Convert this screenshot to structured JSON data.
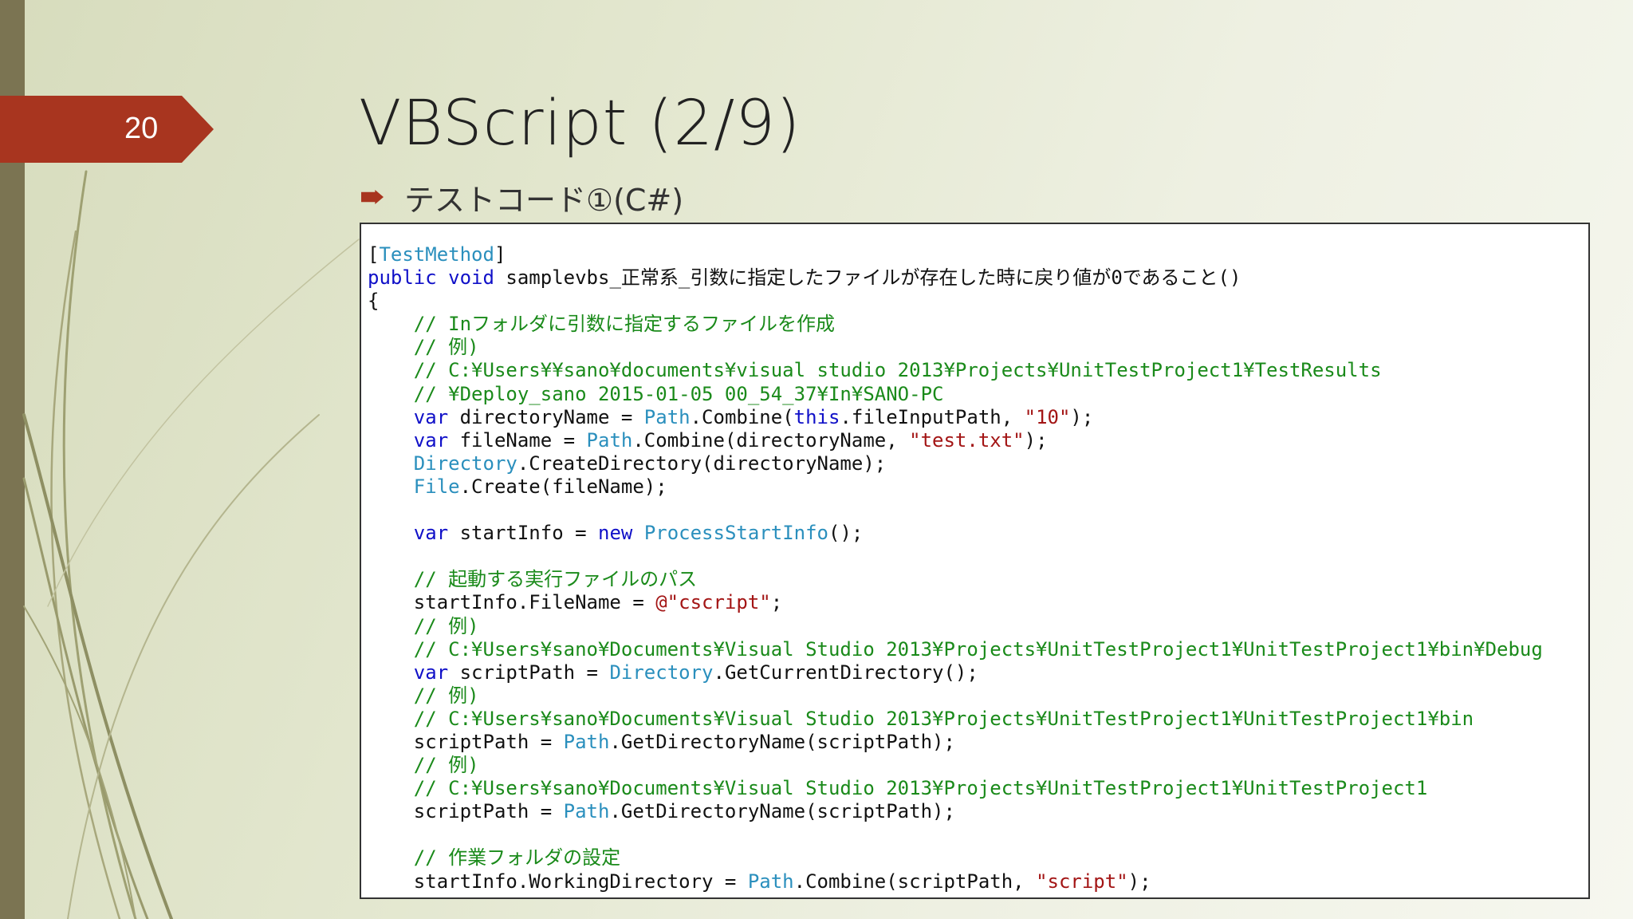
{
  "slide": {
    "number": "20",
    "title": "VBScript (2/9)",
    "bullet": "テストコード①(C#)"
  },
  "colors": {
    "accent": "#a8351f",
    "side_bar": "#7b7452",
    "keyword": "#1010c8",
    "type": "#2a8fbd",
    "comment": "#1a8a1a",
    "string": "#a31515",
    "plain": "#111111"
  },
  "code_lines": [
    [
      [
        "pl",
        "["
      ],
      [
        "ty",
        "TestMethod"
      ],
      [
        "pl",
        "]"
      ]
    ],
    [
      [
        "kw",
        "public"
      ],
      [
        "pl",
        " "
      ],
      [
        "kw",
        "void"
      ],
      [
        "pl",
        " samplevbs_正常系_引数に指定したファイルが存在した時に戻り値が0であること()"
      ]
    ],
    [
      [
        "pl",
        "{"
      ]
    ],
    [
      [
        "cm",
        "    // Inフォルダに引数に指定するファイルを作成"
      ]
    ],
    [
      [
        "cm",
        "    // 例)"
      ]
    ],
    [
      [
        "cm",
        "    // C:¥Users¥¥sano¥documents¥visual studio 2013¥Projects¥UnitTestProject1¥TestResults"
      ]
    ],
    [
      [
        "cm",
        "    // ¥Deploy_sano 2015-01-05 00_54_37¥In¥SANO-PC"
      ]
    ],
    [
      [
        "pl",
        "    "
      ],
      [
        "kw",
        "var"
      ],
      [
        "pl",
        " directoryName = "
      ],
      [
        "ty",
        "Path"
      ],
      [
        "pl",
        ".Combine("
      ],
      [
        "kw",
        "this"
      ],
      [
        "pl",
        ".fileInputPath, "
      ],
      [
        "str",
        "\"10\""
      ],
      [
        "pl",
        ");"
      ]
    ],
    [
      [
        "pl",
        "    "
      ],
      [
        "kw",
        "var"
      ],
      [
        "pl",
        " fileName = "
      ],
      [
        "ty",
        "Path"
      ],
      [
        "pl",
        ".Combine(directoryName, "
      ],
      [
        "str",
        "\"test.txt\""
      ],
      [
        "pl",
        ");"
      ]
    ],
    [
      [
        "pl",
        "    "
      ],
      [
        "ty",
        "Directory"
      ],
      [
        "pl",
        ".CreateDirectory(directoryName);"
      ]
    ],
    [
      [
        "pl",
        "    "
      ],
      [
        "ty",
        "File"
      ],
      [
        "pl",
        ".Create(fileName);"
      ]
    ],
    [],
    [
      [
        "pl",
        "    "
      ],
      [
        "kw",
        "var"
      ],
      [
        "pl",
        " startInfo = "
      ],
      [
        "kw",
        "new"
      ],
      [
        "pl",
        " "
      ],
      [
        "ty",
        "ProcessStartInfo"
      ],
      [
        "pl",
        "();"
      ]
    ],
    [],
    [
      [
        "cm",
        "    // 起動する実行ファイルのパス"
      ]
    ],
    [
      [
        "pl",
        "    startInfo.FileName = "
      ],
      [
        "str",
        "@\"cscript\""
      ],
      [
        "pl",
        ";"
      ]
    ],
    [
      [
        "cm",
        "    // 例)"
      ]
    ],
    [
      [
        "cm",
        "    // C:¥Users¥sano¥Documents¥Visual Studio 2013¥Projects¥UnitTestProject1¥UnitTestProject1¥bin¥Debug"
      ]
    ],
    [
      [
        "pl",
        "    "
      ],
      [
        "kw",
        "var"
      ],
      [
        "pl",
        " scriptPath = "
      ],
      [
        "ty",
        "Directory"
      ],
      [
        "pl",
        ".GetCurrentDirectory();"
      ]
    ],
    [
      [
        "cm",
        "    // 例)"
      ]
    ],
    [
      [
        "cm",
        "    // C:¥Users¥sano¥Documents¥Visual Studio 2013¥Projects¥UnitTestProject1¥UnitTestProject1¥bin"
      ]
    ],
    [
      [
        "pl",
        "    scriptPath = "
      ],
      [
        "ty",
        "Path"
      ],
      [
        "pl",
        ".GetDirectoryName(scriptPath);"
      ]
    ],
    [
      [
        "cm",
        "    // 例)"
      ]
    ],
    [
      [
        "cm",
        "    // C:¥Users¥sano¥Documents¥Visual Studio 2013¥Projects¥UnitTestProject1¥UnitTestProject1"
      ]
    ],
    [
      [
        "pl",
        "    scriptPath = "
      ],
      [
        "ty",
        "Path"
      ],
      [
        "pl",
        ".GetDirectoryName(scriptPath);"
      ]
    ],
    [],
    [
      [
        "cm",
        "    // 作業フォルダの設定"
      ]
    ],
    [
      [
        "pl",
        "    startInfo.WorkingDirectory = "
      ],
      [
        "ty",
        "Path"
      ],
      [
        "pl",
        ".Combine(scriptPath, "
      ],
      [
        "str",
        "\"script\""
      ],
      [
        "pl",
        ");"
      ]
    ]
  ]
}
